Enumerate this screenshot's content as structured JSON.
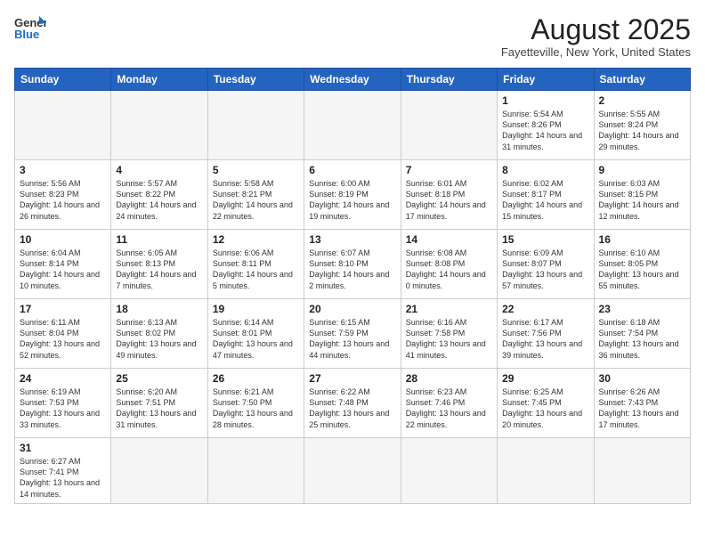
{
  "logo": {
    "text_general": "General",
    "text_blue": "Blue"
  },
  "title": "August 2025",
  "location": "Fayetteville, New York, United States",
  "weekdays": [
    "Sunday",
    "Monday",
    "Tuesday",
    "Wednesday",
    "Thursday",
    "Friday",
    "Saturday"
  ],
  "weeks": [
    [
      {
        "day": "",
        "info": ""
      },
      {
        "day": "",
        "info": ""
      },
      {
        "day": "",
        "info": ""
      },
      {
        "day": "",
        "info": ""
      },
      {
        "day": "",
        "info": ""
      },
      {
        "day": "1",
        "info": "Sunrise: 5:54 AM\nSunset: 8:26 PM\nDaylight: 14 hours and 31 minutes."
      },
      {
        "day": "2",
        "info": "Sunrise: 5:55 AM\nSunset: 8:24 PM\nDaylight: 14 hours and 29 minutes."
      }
    ],
    [
      {
        "day": "3",
        "info": "Sunrise: 5:56 AM\nSunset: 8:23 PM\nDaylight: 14 hours and 26 minutes."
      },
      {
        "day": "4",
        "info": "Sunrise: 5:57 AM\nSunset: 8:22 PM\nDaylight: 14 hours and 24 minutes."
      },
      {
        "day": "5",
        "info": "Sunrise: 5:58 AM\nSunset: 8:21 PM\nDaylight: 14 hours and 22 minutes."
      },
      {
        "day": "6",
        "info": "Sunrise: 6:00 AM\nSunset: 8:19 PM\nDaylight: 14 hours and 19 minutes."
      },
      {
        "day": "7",
        "info": "Sunrise: 6:01 AM\nSunset: 8:18 PM\nDaylight: 14 hours and 17 minutes."
      },
      {
        "day": "8",
        "info": "Sunrise: 6:02 AM\nSunset: 8:17 PM\nDaylight: 14 hours and 15 minutes."
      },
      {
        "day": "9",
        "info": "Sunrise: 6:03 AM\nSunset: 8:15 PM\nDaylight: 14 hours and 12 minutes."
      }
    ],
    [
      {
        "day": "10",
        "info": "Sunrise: 6:04 AM\nSunset: 8:14 PM\nDaylight: 14 hours and 10 minutes."
      },
      {
        "day": "11",
        "info": "Sunrise: 6:05 AM\nSunset: 8:13 PM\nDaylight: 14 hours and 7 minutes."
      },
      {
        "day": "12",
        "info": "Sunrise: 6:06 AM\nSunset: 8:11 PM\nDaylight: 14 hours and 5 minutes."
      },
      {
        "day": "13",
        "info": "Sunrise: 6:07 AM\nSunset: 8:10 PM\nDaylight: 14 hours and 2 minutes."
      },
      {
        "day": "14",
        "info": "Sunrise: 6:08 AM\nSunset: 8:08 PM\nDaylight: 14 hours and 0 minutes."
      },
      {
        "day": "15",
        "info": "Sunrise: 6:09 AM\nSunset: 8:07 PM\nDaylight: 13 hours and 57 minutes."
      },
      {
        "day": "16",
        "info": "Sunrise: 6:10 AM\nSunset: 8:05 PM\nDaylight: 13 hours and 55 minutes."
      }
    ],
    [
      {
        "day": "17",
        "info": "Sunrise: 6:11 AM\nSunset: 8:04 PM\nDaylight: 13 hours and 52 minutes."
      },
      {
        "day": "18",
        "info": "Sunrise: 6:13 AM\nSunset: 8:02 PM\nDaylight: 13 hours and 49 minutes."
      },
      {
        "day": "19",
        "info": "Sunrise: 6:14 AM\nSunset: 8:01 PM\nDaylight: 13 hours and 47 minutes."
      },
      {
        "day": "20",
        "info": "Sunrise: 6:15 AM\nSunset: 7:59 PM\nDaylight: 13 hours and 44 minutes."
      },
      {
        "day": "21",
        "info": "Sunrise: 6:16 AM\nSunset: 7:58 PM\nDaylight: 13 hours and 41 minutes."
      },
      {
        "day": "22",
        "info": "Sunrise: 6:17 AM\nSunset: 7:56 PM\nDaylight: 13 hours and 39 minutes."
      },
      {
        "day": "23",
        "info": "Sunrise: 6:18 AM\nSunset: 7:54 PM\nDaylight: 13 hours and 36 minutes."
      }
    ],
    [
      {
        "day": "24",
        "info": "Sunrise: 6:19 AM\nSunset: 7:53 PM\nDaylight: 13 hours and 33 minutes."
      },
      {
        "day": "25",
        "info": "Sunrise: 6:20 AM\nSunset: 7:51 PM\nDaylight: 13 hours and 31 minutes."
      },
      {
        "day": "26",
        "info": "Sunrise: 6:21 AM\nSunset: 7:50 PM\nDaylight: 13 hours and 28 minutes."
      },
      {
        "day": "27",
        "info": "Sunrise: 6:22 AM\nSunset: 7:48 PM\nDaylight: 13 hours and 25 minutes."
      },
      {
        "day": "28",
        "info": "Sunrise: 6:23 AM\nSunset: 7:46 PM\nDaylight: 13 hours and 22 minutes."
      },
      {
        "day": "29",
        "info": "Sunrise: 6:25 AM\nSunset: 7:45 PM\nDaylight: 13 hours and 20 minutes."
      },
      {
        "day": "30",
        "info": "Sunrise: 6:26 AM\nSunset: 7:43 PM\nDaylight: 13 hours and 17 minutes."
      }
    ],
    [
      {
        "day": "31",
        "info": "Sunrise: 6:27 AM\nSunset: 7:41 PM\nDaylight: 13 hours and 14 minutes."
      },
      {
        "day": "",
        "info": ""
      },
      {
        "day": "",
        "info": ""
      },
      {
        "day": "",
        "info": ""
      },
      {
        "day": "",
        "info": ""
      },
      {
        "day": "",
        "info": ""
      },
      {
        "day": "",
        "info": ""
      }
    ]
  ]
}
